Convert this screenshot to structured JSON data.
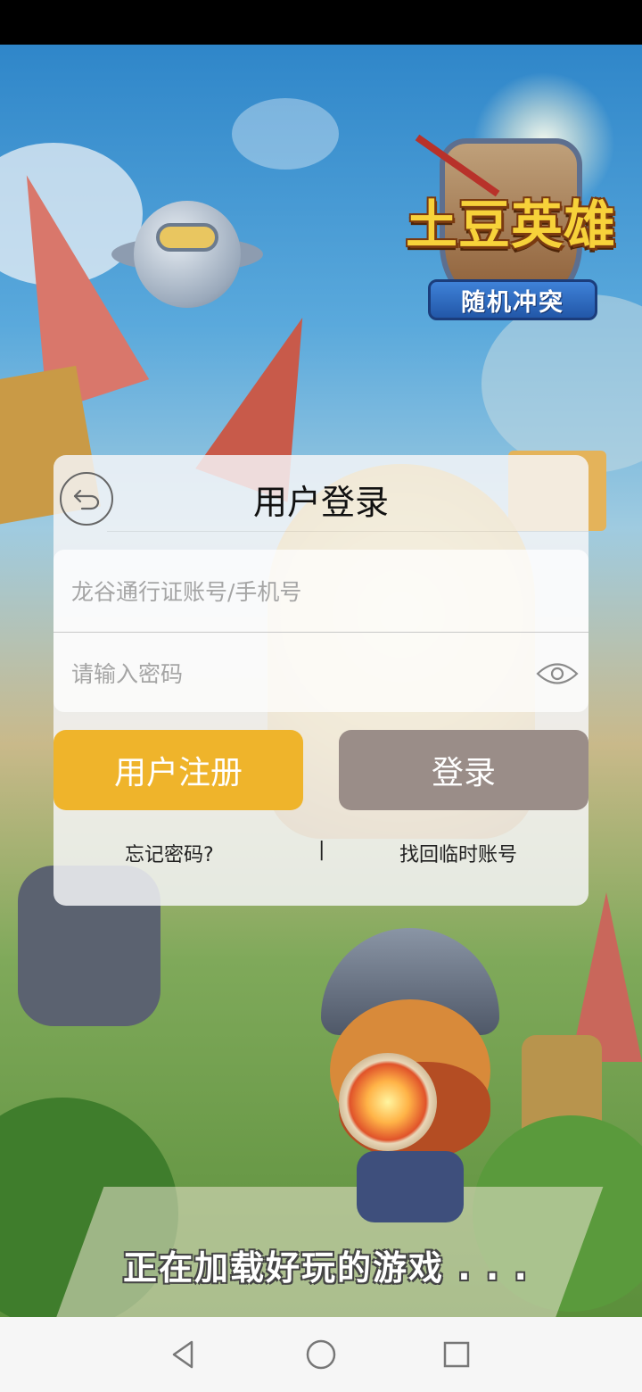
{
  "game": {
    "logo_title": "土豆英雄",
    "logo_subtitle": "随机冲突",
    "loading_text": "正在加载好玩的游戏 . . ."
  },
  "login": {
    "title": "用户登录",
    "account_placeholder": "龙谷通行证账号/手机号",
    "password_placeholder": "请输入密码",
    "register_label": "用户注册",
    "login_label": "登录",
    "forgot_label": "忘记密码?",
    "separator": "|",
    "recover_label": "找回临时账号"
  },
  "colors": {
    "register_button": "#efb42b",
    "login_button": "#9a8d88",
    "panel_background": "#f6f6f8"
  },
  "icons": {
    "back": "back-arrow-icon",
    "password_visibility": "eye-icon",
    "nav_back": "triangle-back-icon",
    "nav_home": "circle-home-icon",
    "nav_recent": "square-recent-icon"
  }
}
